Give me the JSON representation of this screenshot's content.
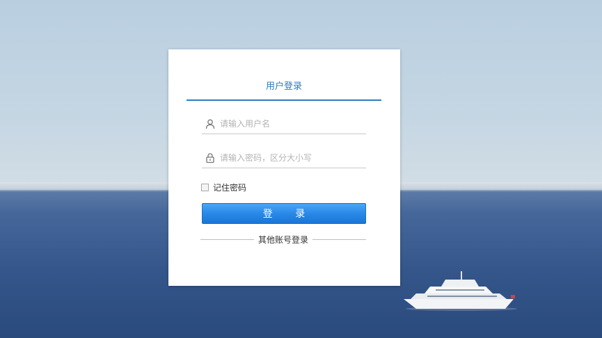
{
  "login": {
    "title": "用户登录",
    "username_placeholder": "请输入用户名",
    "password_placeholder": "请输入密码，区分大小写",
    "remember_label": "记住密码",
    "login_button": "登 录",
    "other_login": "其他账号登录"
  },
  "colors": {
    "accent": "#2b7cc1",
    "button": "#2a88e8"
  },
  "icons": {
    "username": "user-icon",
    "password": "lock-icon",
    "background": "yacht-image"
  }
}
